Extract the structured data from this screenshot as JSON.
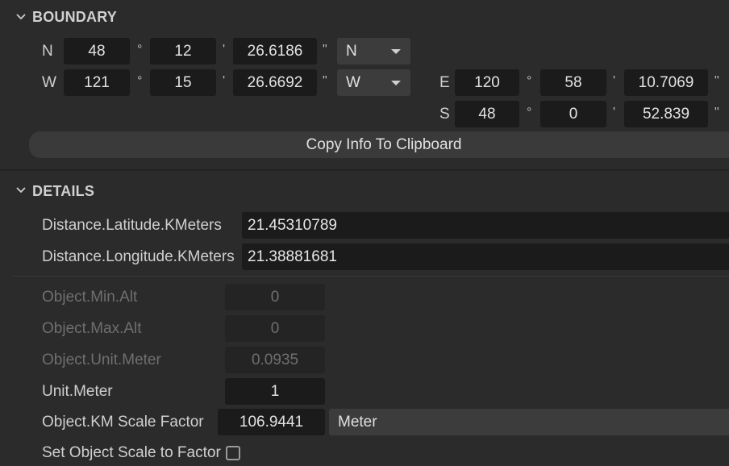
{
  "boundary": {
    "title": "BOUNDARY",
    "row_n": {
      "label": "N",
      "deg": "48",
      "min": "12",
      "sec": "26.6186",
      "hemi": "N"
    },
    "row_w": {
      "label": "W",
      "deg": "121",
      "min": "15",
      "sec": "26.6692",
      "hemi": "W"
    },
    "row_e": {
      "label": "E",
      "deg": "120",
      "min": "58",
      "sec": "10.7069"
    },
    "row_s": {
      "label": "S",
      "deg": "48",
      "min": "0",
      "sec": "52.839"
    },
    "symbols": {
      "deg": "°",
      "min": "'",
      "sec": "\""
    },
    "copy_button": "Copy Info To Clipboard"
  },
  "details": {
    "title": "DETAILS",
    "lat_label": "Distance.Latitude.KMeters",
    "lat_value": "21.45310789",
    "lon_label": "Distance.Longitude.KMeters",
    "lon_value": "21.38881681",
    "min_alt_label": "Object.Min.Alt",
    "min_alt_value": "0",
    "max_alt_label": "Object.Max.Alt",
    "max_alt_value": "0",
    "obj_unit_label": "Object.Unit.Meter",
    "obj_unit_value": "0.0935",
    "unit_label": "Unit.Meter",
    "unit_value": "1",
    "scale_label": "Object.KM Scale Factor",
    "scale_value": "106.9441",
    "scale_unit": "Meter",
    "set_scale_label": "Set Object Scale to Factor"
  }
}
